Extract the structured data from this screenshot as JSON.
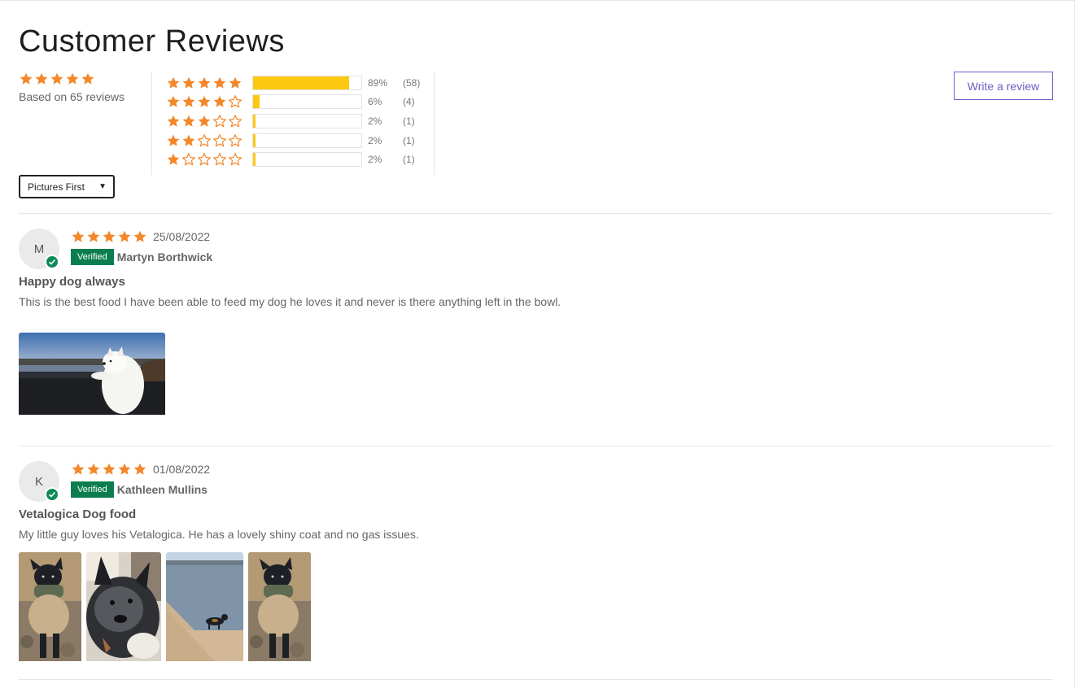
{
  "page": {
    "title": "Customer Reviews"
  },
  "colors": {
    "star": "#f3872a",
    "bar": "#fcc90f",
    "verified": "#0c7d4f",
    "accent": "#6b5fc7"
  },
  "summary": {
    "rating": 5,
    "based_on": "Based on 65 reviews"
  },
  "histogram": [
    {
      "stars": 5,
      "fraction": 0.89,
      "percent": "89%",
      "count": "(58)"
    },
    {
      "stars": 4,
      "fraction": 0.06,
      "percent": "6%",
      "count": "(4)"
    },
    {
      "stars": 3,
      "fraction": 0.02,
      "percent": "2%",
      "count": "(1)"
    },
    {
      "stars": 2,
      "fraction": 0.02,
      "percent": "2%",
      "count": "(1)"
    },
    {
      "stars": 1,
      "fraction": 0.02,
      "percent": "2%",
      "count": "(1)"
    }
  ],
  "actions": {
    "write_review": "Write a review"
  },
  "sort": {
    "selected": "Pictures First",
    "caret": "▼"
  },
  "reviews": [
    {
      "initial": "M",
      "rating": 5,
      "date": "25/08/2022",
      "badge": "Verified",
      "name": "Martyn Borthwick",
      "title": "Happy dog always",
      "body": "This is the best food I have been able to feed my dog he loves it and never is there anything left in the bowl.",
      "photos": [
        "samoyed-by-lake-photo"
      ]
    },
    {
      "initial": "K",
      "rating": 5,
      "date": "01/08/2022",
      "badge": "Verified",
      "name": "Kathleen Mullins",
      "title": "Vetalogica Dog food",
      "body": "My little guy loves his Vetalogica. He has a lovely shiny coat and no gas issues.",
      "photos": [
        "dog-in-sweater-photo",
        "dog-closeup-photo",
        "dog-on-beach-photo",
        "dog-in-sweater-photo"
      ]
    }
  ]
}
